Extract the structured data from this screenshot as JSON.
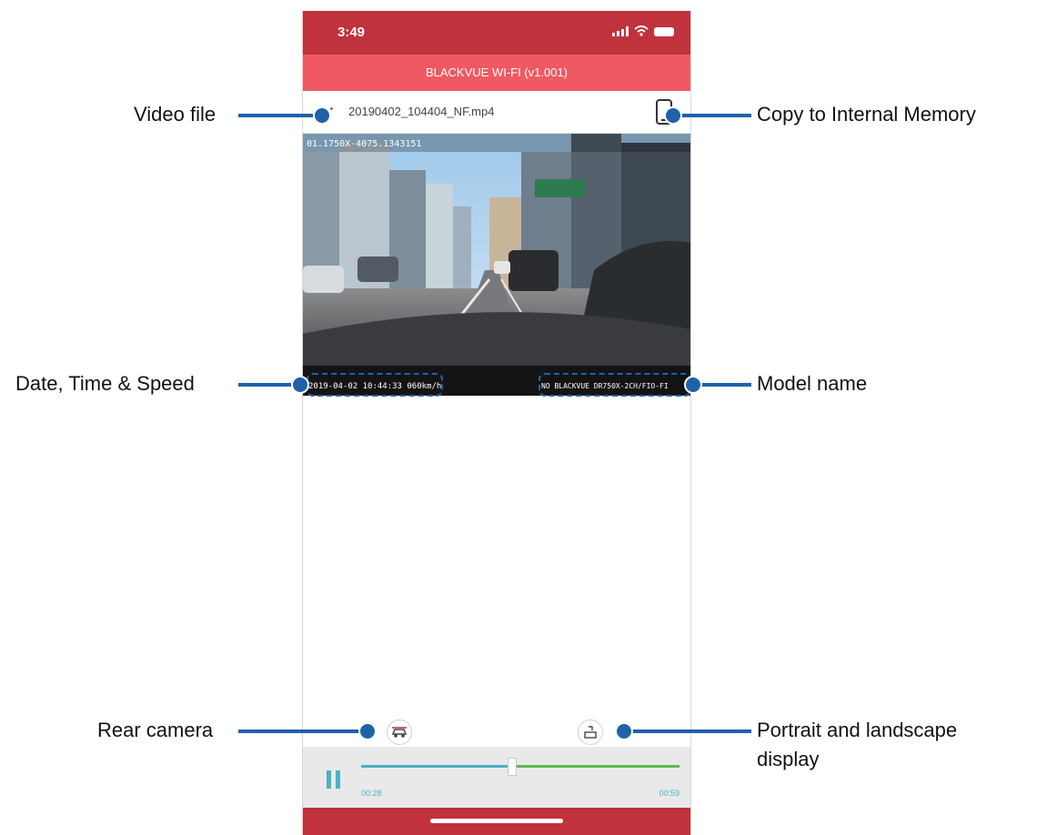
{
  "status_bar": {
    "time": "3:49"
  },
  "app": {
    "title": "BLACKVUE WI-FI (v1.001)"
  },
  "file": {
    "name": "20190402_104404_NF.mp4"
  },
  "video": {
    "overlay_top_left": "01.1750X-4075.1343151",
    "overlay_datetime_speed": "2019-04-02 10:44:33 060km/h",
    "overlay_model": "NO BLACKVUE DR750X-2CH/FIO-FI"
  },
  "player": {
    "current_time": "00:28",
    "total_time": "00:59",
    "progress": 0.47
  },
  "annotations": {
    "video_file": "Video file",
    "copy": "Copy to Internal Memory",
    "datetime": "Date, Time & Speed",
    "model": "Model name",
    "rear": "Rear camera",
    "orientation_line1": "Portrait and landscape",
    "orientation_line2": "display"
  },
  "colors": {
    "status_bar": "#c0323c",
    "title_bar": "#ef5a62",
    "callout": "#1f62a8",
    "progress_played": "#4ab3c4",
    "progress_remaining": "#5fba4f"
  },
  "icons": {
    "copy": "phone-download-icon",
    "rear": "rear-camera-icon",
    "orientation": "rotate-screen-icon",
    "pause": "pause-icon"
  }
}
